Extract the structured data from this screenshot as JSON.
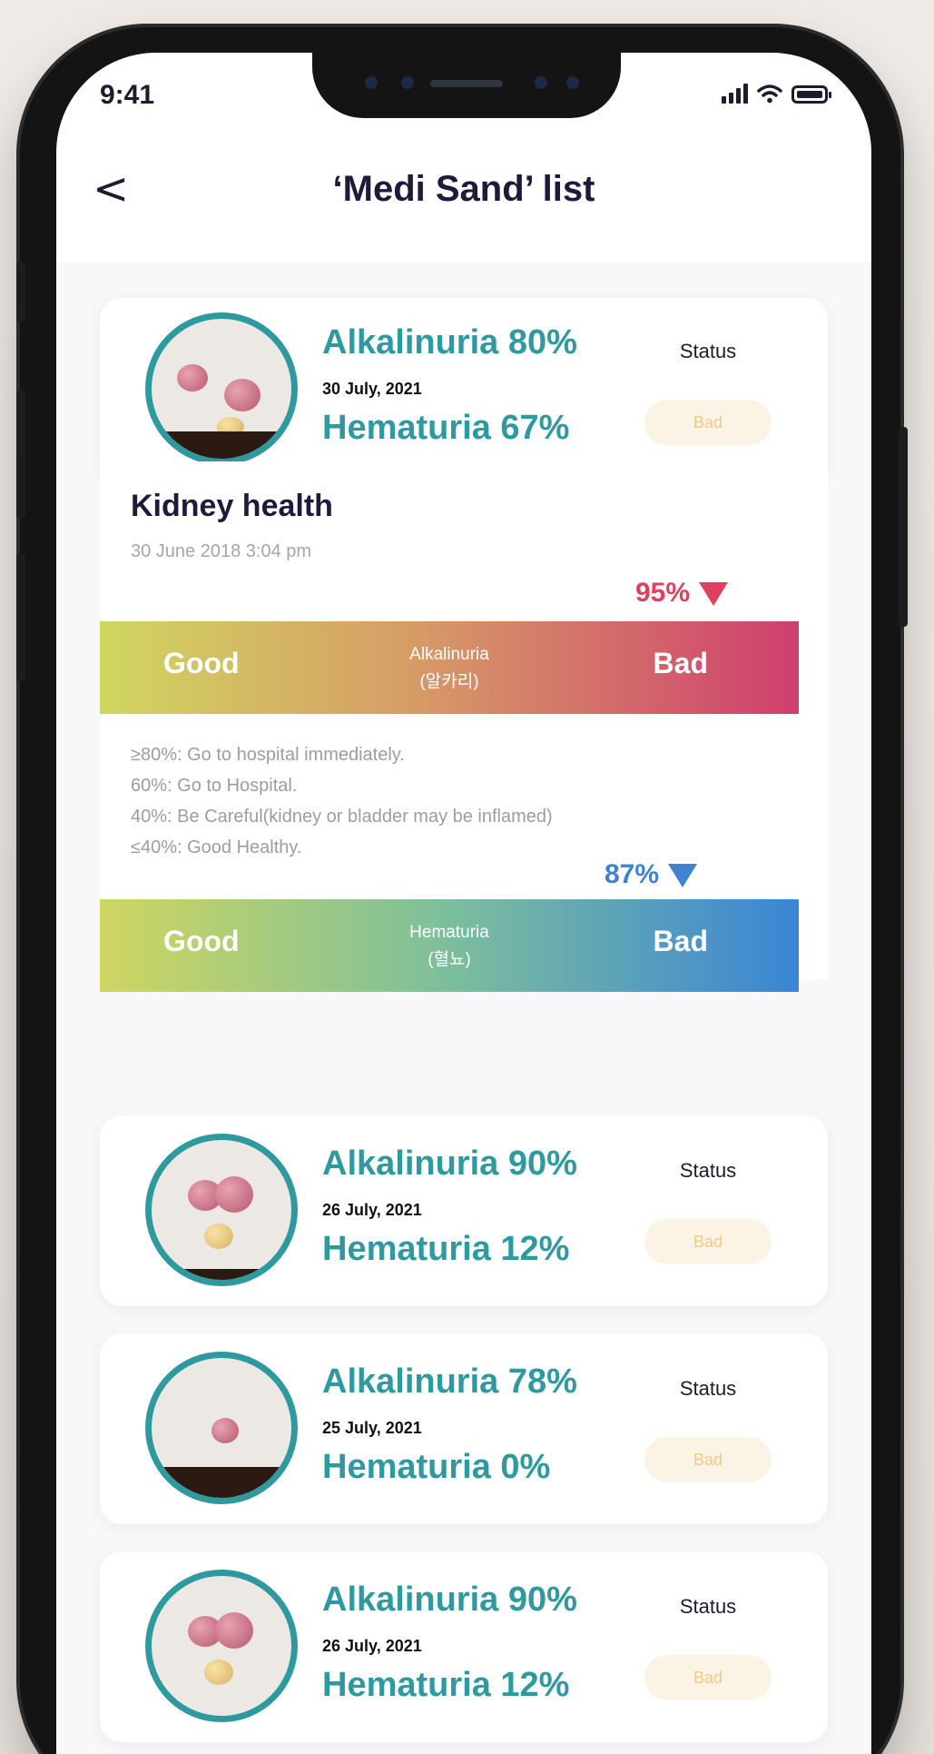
{
  "status_bar": {
    "time": "9:41"
  },
  "header": {
    "title": "‘Medi Sand’ list",
    "back": "<"
  },
  "records": [
    {
      "alkalinuria": "Alkalinuria 80%",
      "date": "30 July, 2021",
      "hematuria": "Hematuria 67%",
      "status_label": "Status",
      "status": "Bad"
    },
    {
      "alkalinuria": "Alkalinuria 90%",
      "date": "26 July, 2021",
      "hematuria": "Hematuria 12%",
      "status_label": "Status",
      "status": "Bad"
    },
    {
      "alkalinuria": "Alkalinuria 78%",
      "date": "25 July, 2021",
      "hematuria": "Hematuria 0%",
      "status_label": "Status",
      "status": "Bad"
    },
    {
      "alkalinuria": "Alkalinuria 90%",
      "date": "26 July, 2021",
      "hematuria": "Hematuria 12%",
      "status_label": "Status",
      "status": "Bad"
    }
  ],
  "kidney_health": {
    "title": "Kidney health",
    "date": "30 June 2018 3:04 pm",
    "alkalinuria_gauge": {
      "value_label": "95%",
      "value": 0.95,
      "good": "Good",
      "bad": "Bad",
      "name": "Alkalinuria",
      "name_ko": "(알카리)",
      "marker_color": "#e0405f"
    },
    "hematuria_gauge": {
      "value_label": "87%",
      "value": 0.87,
      "good": "Good",
      "bad": "Bad",
      "name": "Hematuria",
      "name_ko": "(혈뇨)",
      "marker_color": "#3f82d0"
    },
    "legend": [
      "≥80%: Go to hospital immediately.",
      "60%: Go to Hospital.",
      "40%: Be Careful(kidney or bladder may be inflamed)",
      "≤40%: Good Healthy."
    ]
  },
  "colors": {
    "accent": "#2e9aa0",
    "alk_gradient": [
      "#cfd660",
      "#d79a6a",
      "#cf3f6e"
    ],
    "hem_gradient": [
      "#cfd660",
      "#6fb9a5",
      "#3a85d6"
    ]
  }
}
